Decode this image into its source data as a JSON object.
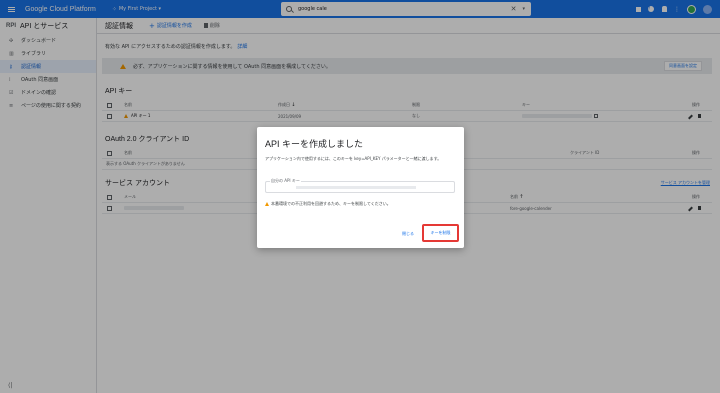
{
  "topbar": {
    "app_title": "Google Cloud Platform",
    "project": "My First Project",
    "search_value": "google cale",
    "clear_glyph": "✕",
    "arrow_glyph": "▾",
    "icons": [
      "gift-icon",
      "help-icon",
      "notifications-icon",
      "more-vert-icon",
      "avatar"
    ]
  },
  "sidebar": {
    "logo": "RPI",
    "title": "API とサービス",
    "items": [
      {
        "icon": "✣",
        "label": "ダッシュボード"
      },
      {
        "icon": "▥",
        "label": "ライブラリ"
      },
      {
        "icon": "⚷",
        "label": "認証情報"
      },
      {
        "icon": "⁞",
        "label": "OAuth 同意画面"
      },
      {
        "icon": "☑",
        "label": "ドメインの確認"
      },
      {
        "icon": "≡",
        "label": "ページの使用に関する契約"
      }
    ],
    "active_index": 2,
    "collapse_glyph": "⟨|"
  },
  "main": {
    "title": "認証情報",
    "create_button": "認証情報を作成",
    "delete_button": "削除",
    "intro_text": "有効な API にアクセスするための認証情報を作成します。",
    "intro_link": "詳細",
    "warning_text": "必ず、アプリケーションに関する情報を使用して OAuth 同意画面を構成してください。",
    "warning_button": "同意画面を設定",
    "api_keys": {
      "section_title": "API キー",
      "headers": [
        "名前",
        "作成日",
        "制限",
        "キー",
        "操作"
      ],
      "rows": [
        {
          "name": "API キー 1",
          "created": "2021/09/09",
          "restriction": "なし"
        }
      ]
    },
    "oauth": {
      "section_title": "OAuth 2.0 クライアント ID",
      "headers": [
        "名前",
        "クライアント ID",
        "操作"
      ],
      "empty_text": "表示する OAuth クライアントがありません"
    },
    "service_accounts": {
      "section_title": "サービス アカウント",
      "manage_link": "サービス アカウントを管理",
      "headers": [
        "メール",
        "名前",
        "操作"
      ],
      "rows": [
        {
          "name": "fore-google-calender"
        }
      ]
    }
  },
  "dialog": {
    "title": "API キーを作成しました",
    "description": "アプリケーション内で使用するには、このキーを key=API_KEY パラメーターと一緒に渡します。",
    "field_label": "自分の API キー",
    "warning": "本番環境での不正利用を回避するため、キーを制限してください。",
    "close_button": "閉じる",
    "restrict_button": "キーを制限"
  }
}
